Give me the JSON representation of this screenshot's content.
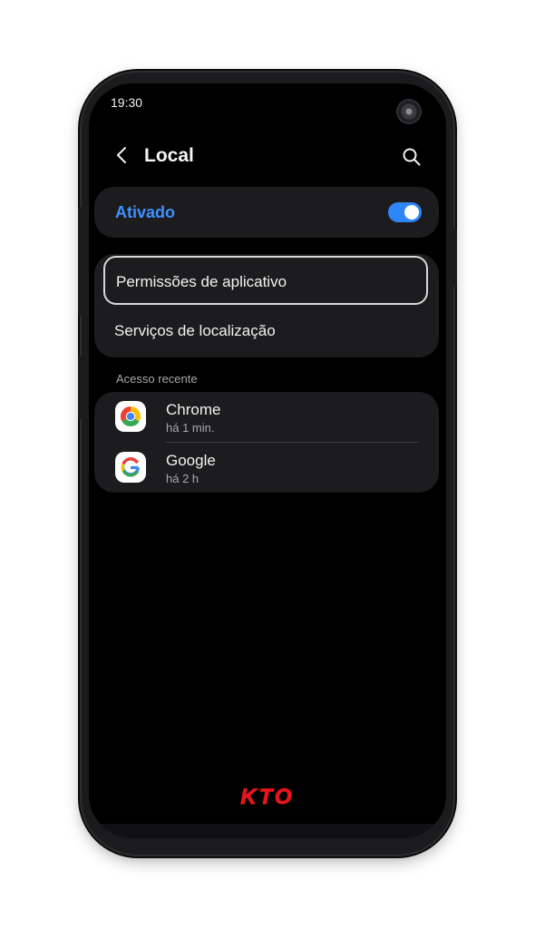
{
  "status_bar": {
    "time": "19:30"
  },
  "header": {
    "title": "Local",
    "back_icon": "chevron-left-icon",
    "search_icon": "search-icon"
  },
  "location_toggle": {
    "label": "Ativado",
    "state": "on",
    "accent_color": "#3e91ff"
  },
  "menu": {
    "items": [
      {
        "label": "Permissões de aplicativo",
        "selected": true
      },
      {
        "label": "Serviços de localização",
        "selected": false
      }
    ]
  },
  "recent_access": {
    "section_label": "Acesso recente",
    "apps": [
      {
        "name": "Chrome",
        "time": "há 1 min.",
        "icon": "chrome-icon"
      },
      {
        "name": "Google",
        "time": "há 2 h",
        "icon": "google-icon"
      }
    ]
  },
  "branding": {
    "logo_text": "KTO",
    "logo_color": "#e8141c"
  }
}
